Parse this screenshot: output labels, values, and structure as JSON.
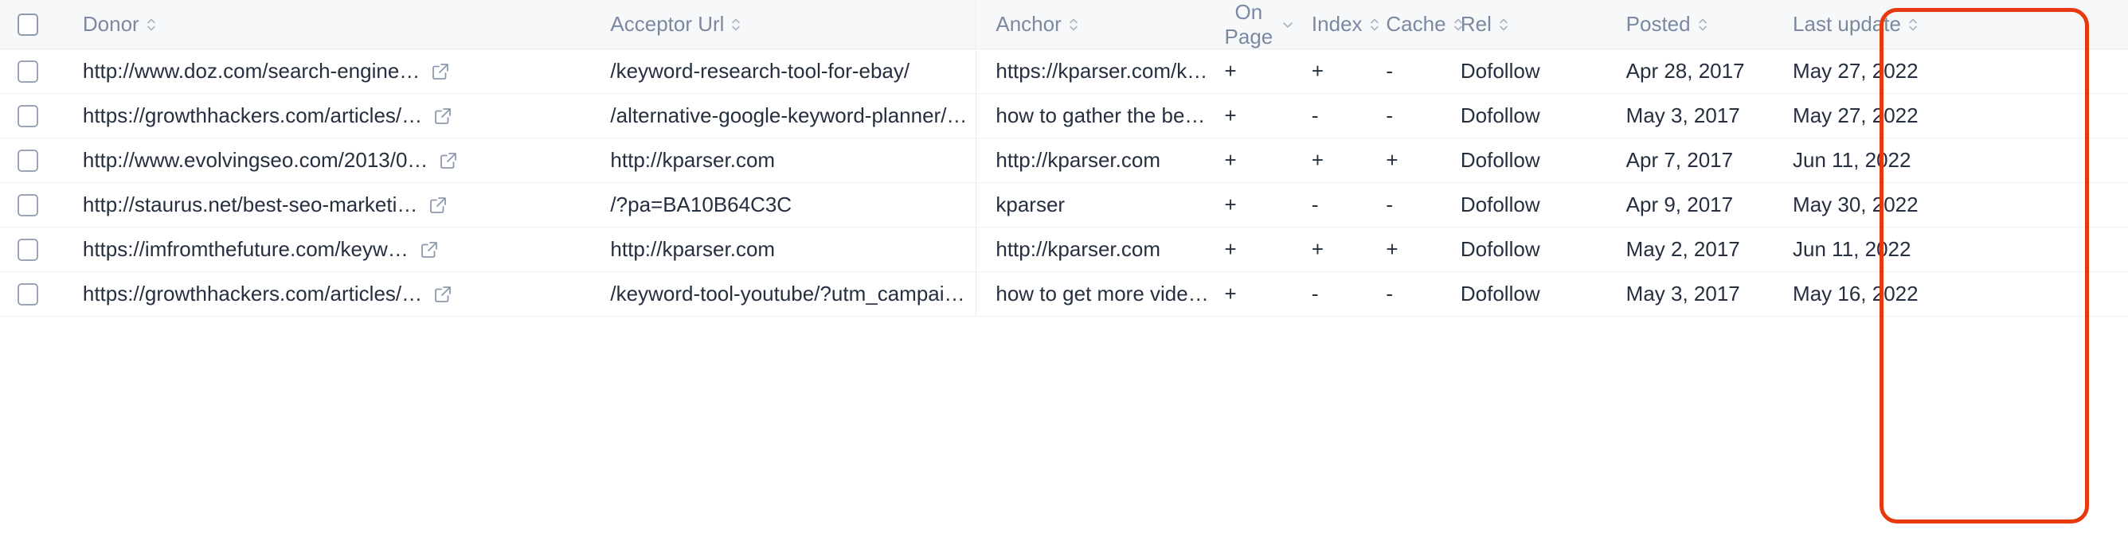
{
  "table": {
    "select_all_checkbox": "unchecked",
    "columns": [
      {
        "key": "select",
        "label": "",
        "icon": "checkbox",
        "align": "left"
      },
      {
        "key": "donor",
        "label": "Donor",
        "icon": "sort-icon",
        "align": "left"
      },
      {
        "key": "acceptor",
        "label": "Acceptor Url",
        "icon": "sort-icon",
        "align": "left"
      },
      {
        "key": "anchor",
        "label": "Anchor",
        "icon": "sort-icon",
        "align": "left"
      },
      {
        "key": "on_page",
        "label": "On Page",
        "icon": "chevron-down-icon",
        "align": "left"
      },
      {
        "key": "index",
        "label": "Index",
        "icon": "sort-icon",
        "align": "left"
      },
      {
        "key": "cache",
        "label": "Cache",
        "icon": "sort-icon",
        "align": "left"
      },
      {
        "key": "rel",
        "label": "Rel",
        "icon": "sort-icon",
        "align": "left"
      },
      {
        "key": "posted",
        "label": "Posted",
        "icon": "sort-icon",
        "align": "left"
      },
      {
        "key": "last_update",
        "label": "Last update",
        "icon": "sort-icon",
        "align": "left"
      }
    ],
    "headers": {
      "donor": "Donor",
      "acceptor_url": "Acceptor Url",
      "anchor": "Anchor",
      "on_page_line1": "On",
      "on_page_line2": "Page",
      "index": "Index",
      "cache": "Cache",
      "rel": "Rel",
      "posted": "Posted",
      "last_update": "Last update"
    },
    "rows": [
      {
        "donor": "http://www.doz.com/search-engine…",
        "acceptor_url": "/keyword-research-tool-for-ebay/",
        "anchor": "https://kparser.com/k…",
        "on_page": "+",
        "index": "+",
        "cache": "-",
        "rel": "Dofollow",
        "posted": "Apr 28, 2017",
        "last_update": "May 27, 2022",
        "checkbox": "unchecked",
        "external_link": "external-link-icon"
      },
      {
        "donor": "https://growthhackers.com/articles/…",
        "acceptor_url": "/alternative-google-keyword-planner/…",
        "anchor": "how to gather the be…",
        "on_page": "+",
        "index": "-",
        "cache": "-",
        "rel": "Dofollow",
        "posted": "May 3, 2017",
        "last_update": "May 27, 2022",
        "checkbox": "unchecked",
        "external_link": "external-link-icon"
      },
      {
        "donor": "http://www.evolvingseo.com/2013/0…",
        "acceptor_url": "http://kparser.com",
        "anchor": "http://kparser.com",
        "on_page": "+",
        "index": "+",
        "cache": "+",
        "rel": "Dofollow",
        "posted": "Apr 7, 2017",
        "last_update": "Jun 11, 2022",
        "checkbox": "unchecked",
        "external_link": "external-link-icon"
      },
      {
        "donor": "http://staurus.net/best-seo-marketi…",
        "acceptor_url": "/?pa=BA10B64C3C",
        "anchor": "kparser",
        "on_page": "+",
        "index": "-",
        "cache": "-",
        "rel": "Dofollow",
        "posted": "Apr 9, 2017",
        "last_update": "May 30, 2022",
        "checkbox": "unchecked",
        "external_link": "external-link-icon"
      },
      {
        "donor": "https://imfromthefuture.com/keyw…",
        "acceptor_url": "http://kparser.com",
        "anchor": "http://kparser.com",
        "on_page": "+",
        "index": "+",
        "cache": "+",
        "rel": "Dofollow",
        "posted": "May 2, 2017",
        "last_update": "Jun 11, 2022",
        "checkbox": "unchecked",
        "external_link": "external-link-icon"
      },
      {
        "donor": "https://growthhackers.com/articles/…",
        "acceptor_url": "/keyword-tool-youtube/?utm_campai…",
        "anchor": "how to get more vide…",
        "on_page": "+",
        "index": "-",
        "cache": "-",
        "rel": "Dofollow",
        "posted": "May 3, 2017",
        "last_update": "May 16, 2022",
        "checkbox": "unchecked",
        "external_link": "external-link-icon"
      }
    ]
  },
  "annotation": {
    "type": "highlight-rectangle",
    "target_column": "Last update",
    "color": "#e8380d"
  },
  "colors": {
    "header_bg": "#f7f8fa",
    "header_text": "#7b88a1",
    "body_text": "#252f3f",
    "row_border": "#edeff3",
    "checkbox_border": "#9aa5b8",
    "highlight": "#e8380d"
  }
}
